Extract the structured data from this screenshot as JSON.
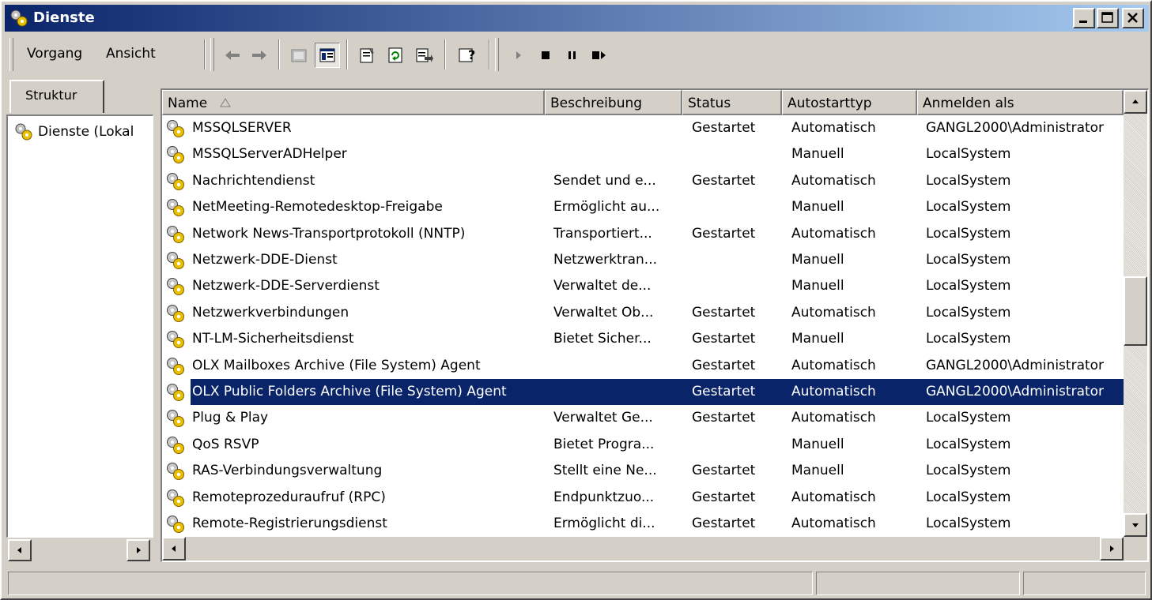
{
  "window": {
    "title": "Dienste",
    "icon": "services-gear-icon"
  },
  "menu": {
    "vorgang": "Vorgang",
    "ansicht": "Ansicht"
  },
  "toolbar": {
    "icons": [
      "back-arrow-icon",
      "forward-arrow-icon",
      "up-level-icon",
      "show-hide-tree-icon",
      "properties-icon",
      "refresh-icon",
      "export-list-icon",
      "help-icon",
      "start-service-icon",
      "stop-service-icon",
      "pause-service-icon",
      "restart-service-icon"
    ]
  },
  "left": {
    "tab": "Struktur",
    "tree_root": "Dienste (Lokal"
  },
  "columns": [
    {
      "label": "Name"
    },
    {
      "label": "Beschreibung"
    },
    {
      "label": "Status"
    },
    {
      "label": "Autostarttyp"
    },
    {
      "label": "Anmelden als"
    }
  ],
  "rows": [
    {
      "name": "MSSQLSERVER",
      "desc": "",
      "status": "Gestartet",
      "start": "Automatisch",
      "logon": "GANGL2000\\Administrator"
    },
    {
      "name": "MSSQLServerADHelper",
      "desc": "",
      "status": "",
      "start": "Manuell",
      "logon": "LocalSystem"
    },
    {
      "name": "Nachrichtendienst",
      "desc": "Sendet und e...",
      "status": "Gestartet",
      "start": "Automatisch",
      "logon": "LocalSystem"
    },
    {
      "name": "NetMeeting-Remotedesktop-Freigabe",
      "desc": "Ermöglicht au...",
      "status": "",
      "start": "Manuell",
      "logon": "LocalSystem"
    },
    {
      "name": "Network News-Transportprotokoll (NNTP)",
      "desc": "Transportiert...",
      "status": "Gestartet",
      "start": "Automatisch",
      "logon": "LocalSystem"
    },
    {
      "name": "Netzwerk-DDE-Dienst",
      "desc": "Netzwerktran...",
      "status": "",
      "start": "Manuell",
      "logon": "LocalSystem"
    },
    {
      "name": "Netzwerk-DDE-Serverdienst",
      "desc": "Verwaltet de...",
      "status": "",
      "start": "Manuell",
      "logon": "LocalSystem"
    },
    {
      "name": "Netzwerkverbindungen",
      "desc": "Verwaltet Ob...",
      "status": "Gestartet",
      "start": "Automatisch",
      "logon": "LocalSystem"
    },
    {
      "name": "NT-LM-Sicherheitsdienst",
      "desc": "Bietet Sicher...",
      "status": "Gestartet",
      "start": "Manuell",
      "logon": "LocalSystem"
    },
    {
      "name": "OLX Mailboxes Archive (File System) Agent",
      "desc": "",
      "status": "Gestartet",
      "start": "Automatisch",
      "logon": "GANGL2000\\Administrator"
    },
    {
      "name": "OLX Public Folders Archive (File System) Agent",
      "desc": "",
      "status": "Gestartet",
      "start": "Automatisch",
      "logon": "GANGL2000\\Administrator",
      "selected": true
    },
    {
      "name": "Plug & Play",
      "desc": "Verwaltet Ge...",
      "status": "Gestartet",
      "start": "Automatisch",
      "logon": "LocalSystem"
    },
    {
      "name": "QoS RSVP",
      "desc": "Bietet Progra...",
      "status": "",
      "start": "Manuell",
      "logon": "LocalSystem"
    },
    {
      "name": "RAS-Verbindungsverwaltung",
      "desc": "Stellt eine Ne...",
      "status": "Gestartet",
      "start": "Manuell",
      "logon": "LocalSystem"
    },
    {
      "name": "Remoteprozeduraufruf (RPC)",
      "desc": "Endpunktzuo...",
      "status": "Gestartet",
      "start": "Automatisch",
      "logon": "LocalSystem"
    },
    {
      "name": "Remote-Registrierungsdienst",
      "desc": "Ermöglicht di...",
      "status": "Gestartet",
      "start": "Automatisch",
      "logon": "LocalSystem"
    }
  ],
  "colors": {
    "title_start": "#0a246a",
    "title_end": "#a6caf0",
    "selection": "#0a246a",
    "face": "#d4d0c8"
  }
}
